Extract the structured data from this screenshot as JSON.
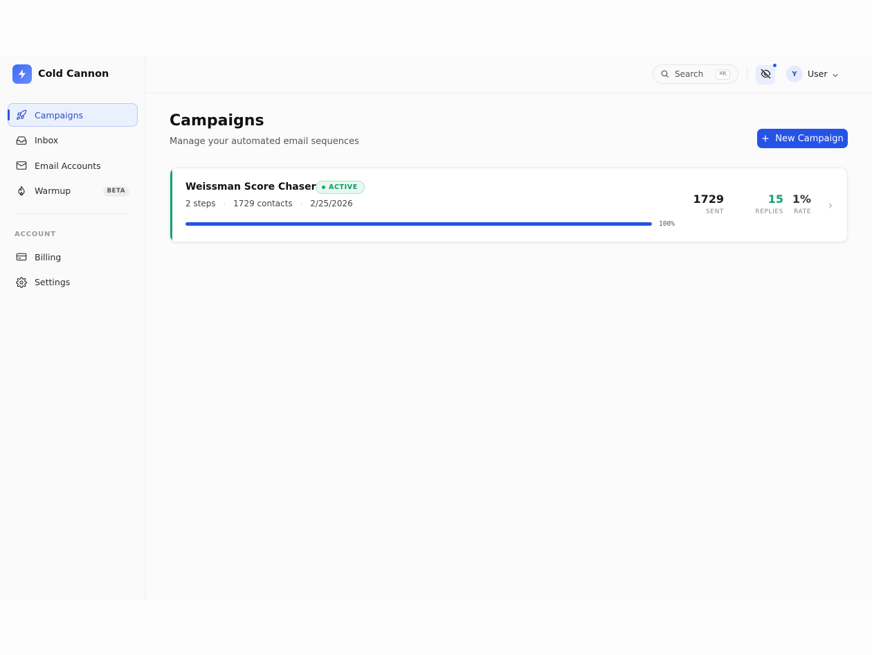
{
  "brand": {
    "name": "Cold Cannon",
    "icon": "bolt-icon"
  },
  "nav": {
    "items": [
      {
        "label": "Campaigns",
        "icon": "rocket-icon",
        "active": true
      },
      {
        "label": "Inbox",
        "icon": "inbox-icon"
      },
      {
        "label": "Email Accounts",
        "icon": "mail-icon"
      },
      {
        "label": "Warmup",
        "icon": "flame-icon",
        "badge": "BETA"
      }
    ],
    "section_label": "ACCOUNT",
    "account_items": [
      {
        "label": "Billing",
        "icon": "credit-card-icon"
      },
      {
        "label": "Settings",
        "icon": "gear-icon"
      }
    ]
  },
  "topbar": {
    "search_label": "Search",
    "search_shortcut": "⌘K",
    "avatar_initial": "Y",
    "user_name": "User"
  },
  "page": {
    "title": "Campaigns",
    "subtitle": "Manage your automated email sequences",
    "new_button_label": "New Campaign"
  },
  "campaign": {
    "name": "Weissman Score Chasers",
    "status": "ACTIVE",
    "steps": "2 steps",
    "contacts": "1729 contacts",
    "date": "2/25/2026",
    "progress_percent": 100,
    "progress_label": "100%",
    "stats": [
      {
        "value": "1729",
        "label": "SENT",
        "color": "#1a1a1a"
      },
      {
        "value": "15",
        "label": "REPLIES",
        "color": "#11a36b"
      },
      {
        "value": "1%",
        "label": "RATE",
        "color": "#333333"
      }
    ]
  },
  "colors": {
    "accent": "#2553e7",
    "success": "#11a36b"
  }
}
